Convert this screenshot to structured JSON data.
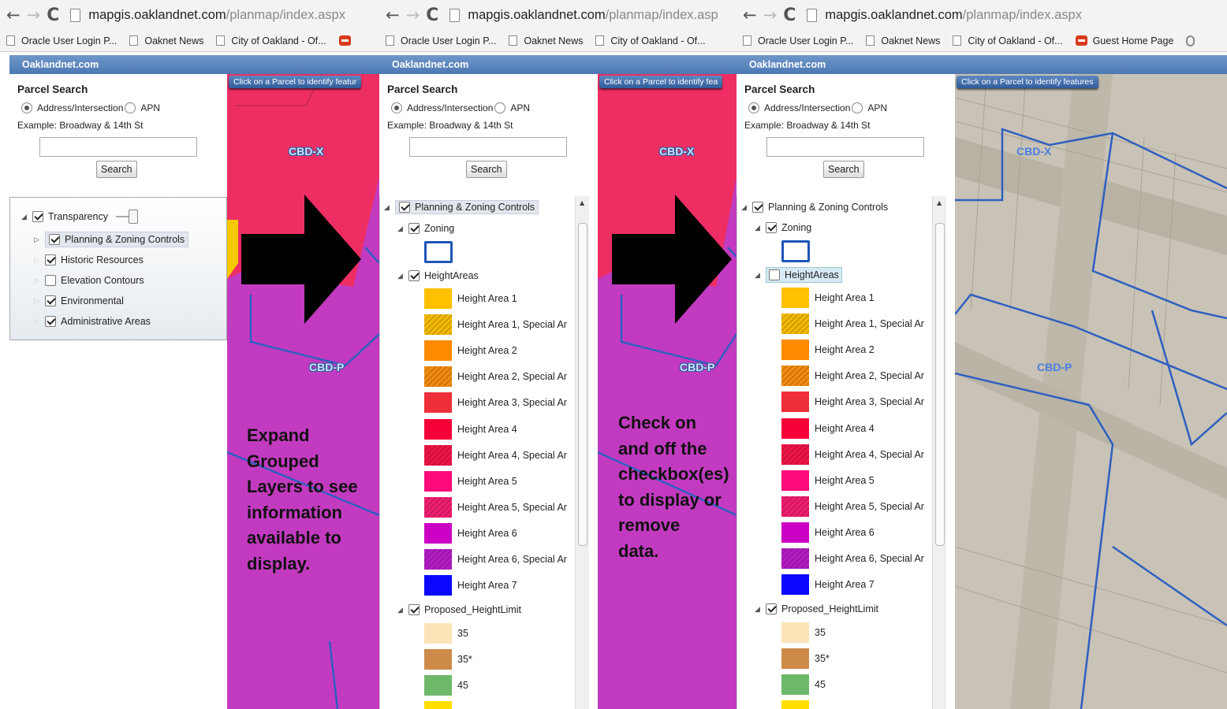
{
  "browser": {
    "url_host": "mapgis.oaklandnet.com",
    "url_path": "/planmap/index.aspx",
    "url_path_cut": "/planmap/index.asp",
    "bookmarks": [
      "Oracle User Login P...",
      "Oaknet News",
      "City of Oakland - Of...",
      "Guest Home Page"
    ]
  },
  "app": {
    "title": "Oaklandnet.com"
  },
  "parcel_search": {
    "title": "Parcel Search",
    "opt_address": "Address/Intersection",
    "opt_apn": "APN",
    "example": "Example: Broadway & 14th St",
    "search_label": "Search",
    "input_value": ""
  },
  "map": {
    "tip": "Click on a Parcel to identify features",
    "tip_cut1": "Click on a Parcel to identify featur",
    "tip_cut2": "Click on a Parcel to identify fea",
    "zone_top": "CBD-X",
    "zone_bottom": "CBD-P"
  },
  "panel1_layers": {
    "transparency": "Transparency",
    "items": [
      {
        "label": "Planning & Zoning Controls",
        "checked": true
      },
      {
        "label": "Historic Resources",
        "checked": true
      },
      {
        "label": "Elevation Contours",
        "checked": false
      },
      {
        "label": "Environmental",
        "checked": true
      },
      {
        "label": "Administrative Areas",
        "checked": true
      }
    ]
  },
  "tree": {
    "group": "Planning & Zoning Controls",
    "zoning": "Zoning",
    "height_areas": "HeightAreas",
    "legend": [
      {
        "label": "Height Area 1",
        "color": "#ffc000"
      },
      {
        "label": "Height Area 1, Special Ar",
        "color": "#f2b800"
      },
      {
        "label": "Height Area 2",
        "color": "#ff8a00"
      },
      {
        "label": "Height Area 2, Special Ar",
        "color": "#f08a10"
      },
      {
        "label": "Height Area 3, Special Ar",
        "color": "#ee2e38"
      },
      {
        "label": "Height Area 4",
        "color": "#f6003a"
      },
      {
        "label": "Height Area 4, Special Ar",
        "color": "#ee1446"
      },
      {
        "label": "Height Area 5",
        "color": "#ff0a7a"
      },
      {
        "label": "Height Area 5, Special Ar",
        "color": "#ee1e6e"
      },
      {
        "label": "Height Area 6",
        "color": "#cc00c4"
      },
      {
        "label": "Height Area 6, Special Ar",
        "color": "#b21cc2"
      },
      {
        "label": "Height Area 7",
        "color": "#0a08ff"
      }
    ],
    "proposed": "Proposed_HeightLimit",
    "proposed_items": [
      {
        "label": "35",
        "color": "#fde3b8"
      },
      {
        "label": "35*",
        "color": "#cd8a48"
      },
      {
        "label": "45",
        "color": "#6eb86a"
      },
      {
        "label": "",
        "color": "#ffde00"
      }
    ]
  },
  "notes": {
    "left": [
      "Expand",
      "Grouped",
      "Layers to see",
      "information",
      "available to",
      "display."
    ],
    "right": [
      "Check on",
      "and off the",
      "checkbox(es)",
      "to display or",
      "remove",
      "data."
    ]
  },
  "colors": {
    "map_magenta": "#c23ac0",
    "map_red": "#ee2e63",
    "boundary": "#2f5fc0",
    "appbar": "#5a85bf"
  }
}
